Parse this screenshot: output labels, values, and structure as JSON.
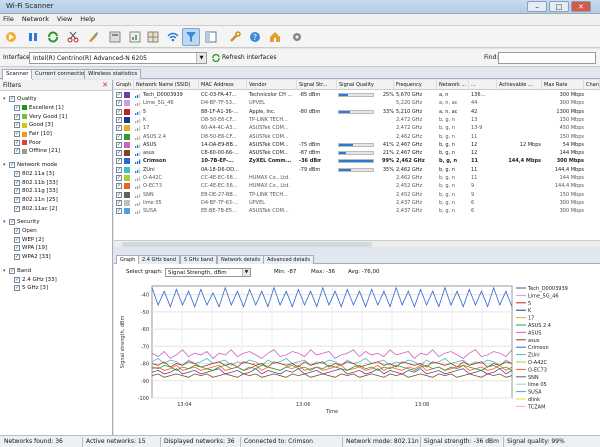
{
  "window": {
    "title": "Wi-Fi Scanner",
    "minimize": "–",
    "maximize": "□",
    "close": "✕"
  },
  "menu": [
    "File",
    "Network",
    "View",
    "Help"
  ],
  "toolbar_icons": [
    "start-scan-icon",
    "pause-icon",
    "refresh-icon",
    "scissors-icon",
    "brush-icon",
    "export-icon",
    "report-icon",
    "filter-icon",
    "panel-toggle-icon",
    "help-icon",
    "wrench-icon",
    "home-icon",
    "settings-icon"
  ],
  "interface": {
    "label": "Interface:",
    "value": "Intel(R) Centrino(R) Advanced-N 6205",
    "refresh": "Refresh interfaces",
    "find_label": "Find:"
  },
  "main_tabs": [
    "Scanner",
    "Current connection",
    "Wireless statistics"
  ],
  "filters": {
    "title": "Filters",
    "tree": [
      {
        "label": "Quality",
        "level": 0,
        "exp": "▾",
        "checked": true
      },
      {
        "label": "Excellent [1]",
        "level": 1,
        "checked": true,
        "color": "#1a9a1a"
      },
      {
        "label": "Very Good [1]",
        "level": 1,
        "checked": true,
        "color": "#6cc23c"
      },
      {
        "label": "Good [3]",
        "level": 1,
        "checked": true,
        "color": "#d8c41a"
      },
      {
        "label": "Fair [10]",
        "level": 1,
        "checked": true,
        "color": "#f09a1a"
      },
      {
        "label": "Poor",
        "level": 1,
        "checked": true,
        "color": "#e0402a"
      },
      {
        "label": "Offline [21]",
        "level": 1,
        "checked": true,
        "color": "#9a9a9a"
      },
      {
        "label": "Network mode",
        "level": 0,
        "exp": "▾",
        "checked": true
      },
      {
        "label": "802.11a [3]",
        "level": 1,
        "checked": true
      },
      {
        "label": "802.11b [33]",
        "level": 1,
        "checked": true
      },
      {
        "label": "802.11g [33]",
        "level": 1,
        "checked": true
      },
      {
        "label": "802.11n [25]",
        "level": 1,
        "checked": true
      },
      {
        "label": "802.11ac [2]",
        "level": 1,
        "checked": true
      },
      {
        "label": "Security",
        "level": 0,
        "exp": "▾",
        "checked": true
      },
      {
        "label": "Open",
        "level": 1,
        "checked": true
      },
      {
        "label": "WEP [2]",
        "level": 1,
        "checked": true
      },
      {
        "label": "WPA [19]",
        "level": 1,
        "checked": true
      },
      {
        "label": "WPA2 [33]",
        "level": 1,
        "checked": true
      },
      {
        "label": "Band",
        "level": 0,
        "exp": "▾",
        "checked": true
      },
      {
        "label": "2.4 GHz [33]",
        "level": 1,
        "checked": true
      },
      {
        "label": "5 GHz [3]",
        "level": 1,
        "checked": true
      }
    ]
  },
  "grid": {
    "headers": [
      "Graph",
      "Network Name (SSID)",
      "MAC Address",
      "Vendor",
      "Signal Str...",
      "Signal Quality",
      "Frequency",
      "Network ...",
      "...",
      "Achievable ...",
      "Max Rate",
      "Chan"
    ],
    "rows": [
      {
        "color": "#6a3fa0",
        "ssid": "Tech_D0003939",
        "mac": "CC-03-FA-47...",
        "vendor": "Technicolor CH ...",
        "sig": "-85 dBm",
        "q": 25,
        "qs": "25%",
        "freq": "5,670 GHz",
        "mode": "a, n",
        "c1": "136...",
        "c2": "",
        "rate": "300 Mbps"
      },
      {
        "color": "#c8a0e0",
        "ssid": "Lime_5G_46",
        "mac": "D4-BF-7F-53...",
        "vendor": "UPVEL",
        "sig": "",
        "q": 0,
        "qs": "",
        "freq": "5,220 GHz",
        "mode": "a, n, ac",
        "c1": "44",
        "c2": "",
        "rate": "300 Mbps"
      },
      {
        "color": "#c42020",
        "ssid": "5",
        "mac": "88-1F-A1-36-...",
        "vendor": "Apple, Inc.",
        "sig": "-80 dBm",
        "q": 33,
        "qs": "33%",
        "freq": "5,210 GHz",
        "mode": "a, n, ac",
        "c1": "42",
        "c2": "",
        "rate": "1300 Mbps"
      },
      {
        "color": "#1a3a9a",
        "ssid": "K",
        "mac": "D8-50-E6-CF...",
        "vendor": "TP-LINK TECH...",
        "sig": "",
        "q": 0,
        "qs": "",
        "freq": "2,472 GHz",
        "mode": "b, g, n",
        "c1": "13",
        "c2": "",
        "rate": "150 Mbps"
      },
      {
        "color": "#e0b020",
        "ssid": "17",
        "mac": "60-A4-4C-A3...",
        "vendor": "ASUSTek COM...",
        "sig": "",
        "q": 0,
        "qs": "",
        "freq": "2,472 GHz",
        "mode": "b, g, n",
        "c1": "13-9",
        "c2": "",
        "rate": "450 Mbps"
      },
      {
        "color": "#2aa02a",
        "ssid": "ASUS 2.4",
        "mac": "D8-50-E6-CF...",
        "vendor": "ASUSTek COM...",
        "sig": "",
        "q": 0,
        "qs": "",
        "freq": "2,462 GHz",
        "mode": "b, g, n",
        "c1": "11",
        "c2": "",
        "rate": "150 Mbps"
      },
      {
        "color": "#d060c0",
        "ssid": "ASUS",
        "mac": "14-DA-E9-BB...",
        "vendor": "ASUSTek COM...",
        "sig": "-75 dBm",
        "q": 41,
        "qs": "41%",
        "freq": "2,467 GHz",
        "mode": "b, g, n",
        "c1": "12",
        "c2": "12 Mbps",
        "rate": "54 Mbps"
      },
      {
        "color": "#7a4a1a",
        "ssid": "asus",
        "mac": "C8-60-00-66-...",
        "vendor": "ASUSTek COM...",
        "sig": "-87 dBm",
        "q": 21,
        "qs": "21%",
        "freq": "2,467 GHz",
        "mode": "b, g, n",
        "c1": "12",
        "c2": "",
        "rate": "144 Mbps"
      },
      {
        "color": "#2a6ad0",
        "ssid": "Crimson",
        "mac": "10-7B-EF-...",
        "vendor": "ZyXEL Comm...",
        "sig": "-36 dBm",
        "q": 99,
        "qs": "99%",
        "freq": "2,462 GHz",
        "mode": "b, g, n",
        "c1": "11",
        "c2": "144,4 Mbps",
        "rate": "300 Mbps",
        "bold": true
      },
      {
        "color": "#40c0c0",
        "ssid": "ZUni",
        "mac": "0A-18-D6-DD...",
        "vendor": "",
        "sig": "-79 dBm",
        "q": 35,
        "qs": "35%",
        "freq": "2,462 GHz",
        "mode": "b, g, n",
        "c1": "11",
        "c2": "",
        "rate": "144,4 Mbps",
        "dark": true
      },
      {
        "color": "#a0d040",
        "ssid": "O-A42C",
        "mac": "CC-4E-EC-58...",
        "vendor": "HUMAX Co., Ltd.",
        "sig": "",
        "q": 0,
        "qs": "",
        "freq": "2,462 GHz",
        "mode": "b, g, n",
        "c1": "11",
        "c2": "",
        "rate": "144 Mbps"
      },
      {
        "color": "#f06020",
        "ssid": "O-EC73",
        "mac": "CC-4E-EC-56...",
        "vendor": "HUMAX Co., Ltd.",
        "sig": "",
        "q": 0,
        "qs": "",
        "freq": "2,452 GHz",
        "mode": "b, g, n",
        "c1": "9",
        "c2": "",
        "rate": "144,4 Mbps"
      },
      {
        "color": "#606060",
        "ssid": "SNN",
        "mac": "E8-DE-27-BB...",
        "vendor": "TP-LINK TECH...",
        "sig": "",
        "q": 0,
        "qs": "",
        "freq": "2,452 GHz",
        "mode": "b, g, n",
        "c1": "9",
        "c2": "",
        "rate": "150 Mbps"
      },
      {
        "color": "#c0c0c0",
        "ssid": "lime 05",
        "mac": "D4-BF-7F-63-...",
        "vendor": "UPVEL",
        "sig": "",
        "q": 0,
        "qs": "",
        "freq": "2,437 GHz",
        "mode": "b, g, n",
        "c1": "6",
        "c2": "",
        "rate": "300 Mbps"
      },
      {
        "color": "#50a0e0",
        "ssid": "SUSA",
        "mac": "EE-BE-7B-E5...",
        "vendor": "ASUSTek COM...",
        "sig": "",
        "q": 0,
        "qs": "",
        "freq": "2,437 GHz",
        "mode": "b, g, n",
        "c1": "6",
        "c2": "",
        "rate": "300 Mbps"
      }
    ]
  },
  "bottom_tabs": [
    "Graph",
    "2.4 GHz band",
    "5 GHz band",
    "Network details",
    "Advanced details"
  ],
  "graph": {
    "select_label": "Select graph:",
    "selected": "Signal Strength, dBm",
    "min": "Min:  -87",
    "max": "Max:  -36",
    "avg": "Avg:  -76,00"
  },
  "chart_data": {
    "type": "line",
    "title": "",
    "xlabel": "Time",
    "ylabel": "Signal strength, dBm",
    "x_ticks": [
      "13:04",
      "13:06",
      "13:08"
    ],
    "y_ticks": [
      -40,
      -50,
      -60,
      -70,
      -80,
      -90,
      -100
    ],
    "ylim": [
      -100,
      -35
    ],
    "grid": true,
    "legend_position": "right",
    "legend": [
      "Tech_D0003939",
      "Lime_5G_46",
      "5",
      "K",
      "17",
      "ASUS 2.4",
      "ASUS",
      "asus",
      "Crimson",
      "ZUni",
      "O-A42C",
      "O-EC73",
      "SNN",
      "lime 05",
      "SUSA",
      "dlink",
      "TCZAM"
    ],
    "series": [
      {
        "name": "Crimson",
        "color": "#2a6ad0",
        "values": [
          -36,
          -46,
          -38,
          -47,
          -37,
          -46,
          -38,
          -47,
          -37,
          -46,
          -39,
          -47,
          -36,
          -46,
          -38,
          -47,
          -37,
          -46,
          -38,
          -47,
          -36,
          -46,
          -38,
          -47,
          -37,
          -46,
          -38,
          -47,
          -36,
          -46,
          -38,
          -47,
          -37,
          -46,
          -38,
          -47,
          -37,
          -46,
          -38,
          -47,
          -36,
          -46,
          -38,
          -47,
          -37,
          -46,
          -38,
          -47,
          -36,
          -46,
          -38,
          -47,
          -37,
          -46,
          -38,
          -47,
          -36,
          -46,
          -38,
          -47
        ]
      },
      {
        "name": "ASUS",
        "color": "#d060c0",
        "values": [
          -74,
          -76,
          -73,
          -77,
          -75,
          -72,
          -76,
          -74,
          -75,
          -73,
          -77,
          -74,
          -75,
          -72,
          -76,
          -74,
          -73,
          -75,
          -77,
          -74,
          -72,
          -76,
          -75,
          -73,
          -74,
          -76,
          -72,
          -75,
          -74,
          -73,
          -77,
          -75,
          -74,
          -72,
          -76,
          -73,
          -75,
          -74,
          -76,
          -72,
          -75,
          -74,
          -73,
          -77,
          -74,
          -75,
          -72,
          -76,
          -74,
          -73,
          -75,
          -77,
          -74,
          -72,
          -76,
          -75,
          -73,
          -74,
          -76,
          -72
        ]
      },
      {
        "name": "ZUni",
        "color": "#40c0c0",
        "values": [
          -79,
          -77,
          -80,
          -78,
          -79,
          -81,
          -78,
          -80,
          -79,
          -77,
          -80,
          -79,
          -78,
          -81,
          -79,
          -80,
          -78,
          -79,
          -81,
          -78,
          -80,
          -79,
          -77,
          -80,
          -79,
          -78,
          -81,
          -79,
          -80,
          -78,
          -79,
          -81,
          -78,
          -80,
          -79,
          -77,
          -80,
          -79,
          -78,
          -81,
          -79,
          -80,
          -78,
          -79,
          -81,
          -78,
          -80,
          -79,
          -77,
          -80,
          -79,
          -78,
          -81,
          -79,
          -80,
          -78,
          -79,
          -81,
          -78,
          -80
        ]
      },
      {
        "name": "5",
        "color": "#c42020",
        "values": [
          -80,
          -81,
          -79,
          -82,
          -80,
          -81,
          -79,
          -80,
          -82,
          -81,
          -80,
          -79,
          -81,
          -80,
          -82,
          -79,
          -80,
          -81,
          -80,
          -82,
          -79,
          -80,
          -81,
          -80,
          -82,
          -79,
          -81,
          -80,
          -79,
          -82,
          -80,
          -81,
          -79,
          -80,
          -82,
          -81,
          -80,
          -79,
          -81,
          -80,
          -82,
          -79,
          -80,
          -81,
          -80,
          -82,
          -79,
          -80,
          -81,
          -80,
          -82,
          -79,
          -81,
          -80,
          -79,
          -82,
          -80,
          -81,
          -79,
          -80
        ]
      },
      {
        "name": "Tech_D0003939",
        "color": "#6a3fa0",
        "values": [
          -85,
          -84,
          -86,
          -85,
          -83,
          -86,
          -85,
          -84,
          -86,
          -85,
          -84,
          -83,
          -86,
          -85,
          -84,
          -86,
          -85,
          -83,
          -86,
          -84,
          -85,
          -86,
          -84,
          -85,
          -83,
          -86,
          -85,
          -84,
          -86,
          -85,
          -84,
          -83,
          -86,
          -85,
          -84,
          -86,
          -85,
          -83,
          -86,
          -84,
          -85,
          -86,
          -84,
          -85,
          -83,
          -86,
          -85,
          -84,
          -86,
          -85,
          -84,
          -83,
          -86,
          -85,
          -84,
          -86,
          -85,
          -83,
          -86,
          -84
        ]
      },
      {
        "name": "asus",
        "color": "#7a4a1a",
        "values": [
          -87,
          -86,
          -88,
          -87,
          -86,
          -87,
          -88,
          -86,
          -87,
          -86,
          -88,
          -87,
          -86,
          -87,
          -88,
          -86,
          -87,
          -86,
          -88,
          -87,
          -86,
          -87,
          -88,
          -86,
          -87,
          -86,
          -88,
          -87,
          -86,
          -87,
          -88,
          -86,
          -87,
          -86,
          -88,
          -87,
          -86,
          -87,
          -88,
          -86,
          -87,
          -86,
          -88,
          -87,
          -86,
          -87,
          -88,
          -86,
          -87,
          -86,
          -88,
          -87,
          -86,
          -87,
          -88,
          -86,
          -87,
          -86,
          -88,
          -87
        ]
      },
      {
        "name": "O-EC73",
        "color": "#f06020",
        "values": [
          -83,
          -82,
          -84,
          -83,
          -81,
          -84,
          -83,
          -82,
          -84,
          -83,
          -82,
          -81,
          -84,
          -83,
          -82,
          -84,
          -83,
          -81,
          -84,
          -82,
          -83,
          -84,
          -82,
          -83,
          -81,
          -84,
          -83,
          -82,
          -84,
          -83,
          -82,
          -81,
          -84,
          -83,
          -82,
          -84,
          -83,
          -81,
          -84,
          -82,
          -83,
          -84,
          -82,
          -83,
          -81,
          -84,
          -83,
          -82,
          -84,
          -83,
          -82,
          -81,
          -84,
          -83,
          -82,
          -84,
          -83,
          -81,
          -84,
          -82
        ]
      },
      {
        "name": "ASUS 2.4",
        "color": "#2aa02a",
        "values": [
          -82,
          -83,
          -81,
          -82,
          -84,
          -82,
          -83,
          -81,
          -82,
          -83,
          -84,
          -82,
          -81,
          -83,
          -82,
          -84,
          -82,
          -83,
          -81,
          -82,
          -83,
          -84,
          -82,
          -81,
          -83,
          -82,
          -84,
          -82,
          -83,
          -81,
          -82,
          -83,
          -84,
          -82,
          -81,
          -83,
          -82,
          -84,
          -82,
          -83,
          -81,
          -82,
          -83,
          -84,
          -82,
          -81,
          -83,
          -82,
          -84,
          -82,
          -83,
          -81,
          -82,
          -83,
          -84,
          -82,
          -81,
          -83,
          -82,
          -84
        ]
      }
    ]
  },
  "status": {
    "found": "Networks found: 36",
    "active": "Active networks: 15",
    "displayed": "Displayed networks: 36",
    "connected": "Connected to:  Crimson",
    "mode": "Network mode: 802.11n",
    "strength": "Signal strength: -36 dBm",
    "quality": "Signal quality: 99%"
  }
}
